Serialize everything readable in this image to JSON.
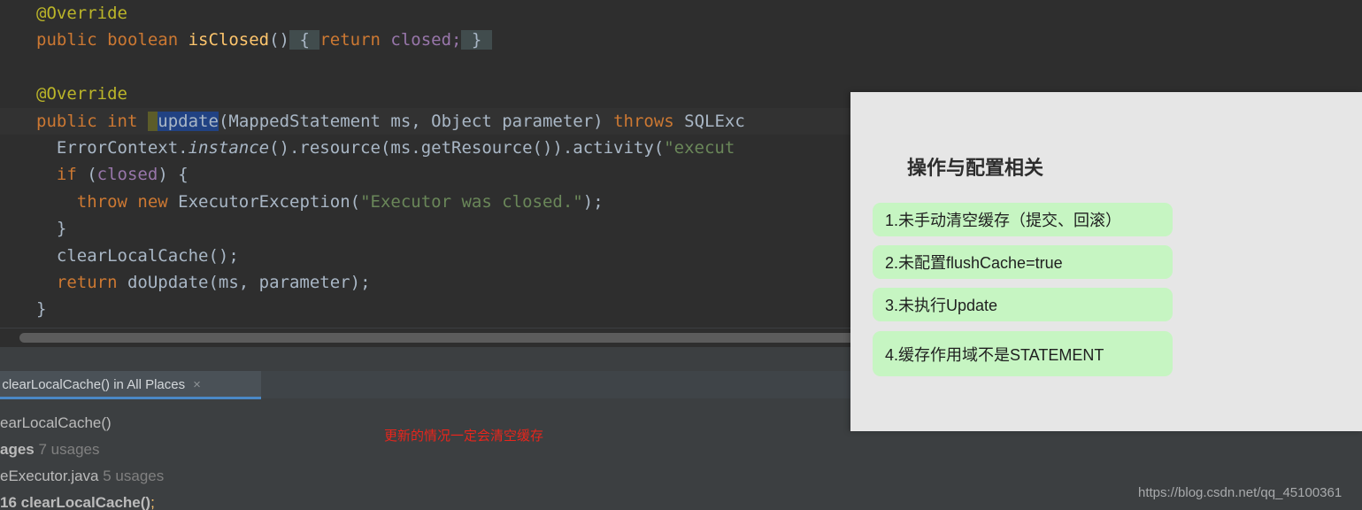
{
  "editor": {
    "language": "java",
    "lines": [
      {
        "id": "line-override-1",
        "text": "@Override",
        "caret": false,
        "segments": [
          {
            "t": "@Override",
            "c": "tok-ann"
          }
        ]
      },
      {
        "id": "line-isclosed",
        "text": "public boolean isClosed() { return closed; }",
        "caret": false,
        "segments": [
          {
            "t": "public ",
            "c": "tok-kw"
          },
          {
            "t": "boolean ",
            "c": "tok-kw"
          },
          {
            "t": "isClosed",
            "c": "tok-meth"
          },
          {
            "t": "()",
            "c": "tok-punct"
          },
          {
            "t": " { ",
            "c": "brace-box"
          },
          {
            "t": "return ",
            "c": "tok-kw"
          },
          {
            "t": "closed;",
            "c": "tok-field"
          },
          {
            "t": " } ",
            "c": "brace-box"
          }
        ]
      },
      {
        "id": "line-blank-1",
        "text": "",
        "caret": false,
        "segments": []
      },
      {
        "id": "line-override-2",
        "text": "@Override",
        "caret": false,
        "segments": [
          {
            "t": "@Override",
            "c": "tok-ann"
          }
        ]
      },
      {
        "id": "line-update-signature",
        "text": "public int update(MappedStatement ms, Object parameter) throws SQLExc",
        "caret": true,
        "segments": [
          {
            "t": "public ",
            "c": "tok-kw"
          },
          {
            "t": "int ",
            "c": "tok-kw"
          },
          {
            "t": " ",
            "c": "sel-pre"
          },
          {
            "t": "update",
            "c": "sel-hl"
          },
          {
            "t": "(MappedStatement ms, Object parameter) ",
            "c": "tok-ident"
          },
          {
            "t": "throws ",
            "c": "tok-kw"
          },
          {
            "t": "SQLExc",
            "c": "tok-ident"
          }
        ]
      },
      {
        "id": "line-errorcontext",
        "text": "  ErrorContext.instance().resource(ms.getResource()).activity(\"execut",
        "caret": false,
        "segments": [
          {
            "t": "  ErrorContext.",
            "c": "tok-ident"
          },
          {
            "t": "instance",
            "c": "tok-italic"
          },
          {
            "t": "().resource(ms.getResource()).activity(",
            "c": "tok-ident"
          },
          {
            "t": "\"execut",
            "c": "tok-str"
          }
        ]
      },
      {
        "id": "line-if-closed",
        "text": "  if (closed) {",
        "caret": false,
        "segments": [
          {
            "t": "  ",
            "c": "tok-ident"
          },
          {
            "t": "if ",
            "c": "tok-kw"
          },
          {
            "t": "(",
            "c": "tok-punct"
          },
          {
            "t": "closed",
            "c": "tok-field"
          },
          {
            "t": ") {",
            "c": "tok-punct"
          }
        ]
      },
      {
        "id": "line-throw",
        "text": "    throw new ExecutorException(\"Executor was closed.\");",
        "caret": false,
        "segments": [
          {
            "t": "    ",
            "c": "tok-ident"
          },
          {
            "t": "throw ",
            "c": "tok-kw"
          },
          {
            "t": "new ",
            "c": "tok-kw"
          },
          {
            "t": "ExecutorException(",
            "c": "tok-ident"
          },
          {
            "t": "\"Executor was closed.\"",
            "c": "tok-str"
          },
          {
            "t": ");",
            "c": "tok-punct"
          }
        ]
      },
      {
        "id": "line-close-if",
        "text": "  }",
        "caret": false,
        "segments": [
          {
            "t": "  }",
            "c": "tok-punct"
          }
        ]
      },
      {
        "id": "line-clearlocalcache",
        "text": "  clearLocalCache();",
        "caret": false,
        "segments": [
          {
            "t": "  clearLocalCache();",
            "c": "tok-ident"
          }
        ]
      },
      {
        "id": "line-return-doupdate",
        "text": "  return doUpdate(ms, parameter);",
        "caret": false,
        "segments": [
          {
            "t": "  ",
            "c": "tok-ident"
          },
          {
            "t": "return ",
            "c": "tok-kw"
          },
          {
            "t": "doUpdate(ms, parameter);",
            "c": "tok-ident"
          }
        ]
      },
      {
        "id": "line-close-method",
        "text": "}",
        "caret": false,
        "segments": [
          {
            "t": "}",
            "c": "tok-punct"
          }
        ]
      }
    ]
  },
  "find_usages": {
    "tab_label": "f clearLocalCache() in All Places",
    "close_label": "×",
    "results": [
      {
        "id": "usages-root",
        "html": "earLocalCache()"
      },
      {
        "id": "usages-group",
        "html": "<span class=\"bold\">ages</span> <span class=\"dim\">7 usages</span>"
      },
      {
        "id": "usages-file",
        "html": "eExecutor.java <span class=\"dim\">5 usages</span>"
      },
      {
        "id": "usages-hit",
        "html": "<span class=\"bold\">16  clearLocalCache()</span><span class=\"meth\">;</span>"
      }
    ]
  },
  "annotation": {
    "red_note": "更新的情况一定会清空缓存"
  },
  "watermark": {
    "text": "https://blog.csdn.net/qq_45100361"
  },
  "popup": {
    "title": "操作与配置相关",
    "background_color": "#e6e6e6",
    "pill_color": "#c6f5c2",
    "items": [
      {
        "label": "1.未手动清空缓存（提交、回滚）"
      },
      {
        "label": "2.未配置flushCache=true"
      },
      {
        "label": "3.未执行Update"
      },
      {
        "label": "4.缓存作用域不是STATEMENT"
      }
    ]
  }
}
